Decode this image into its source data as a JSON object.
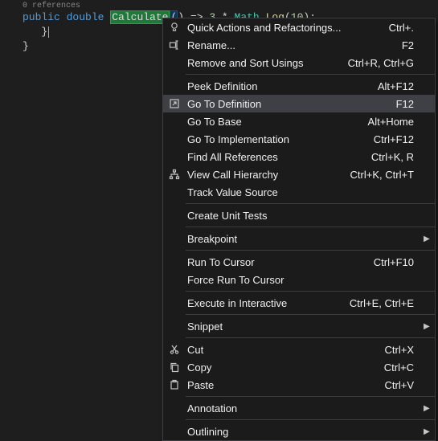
{
  "codelens": "0 references",
  "code": {
    "kw1": "public",
    "kw2": "double",
    "method": "Calculate",
    "paren_open": "(",
    "paren_close": ")",
    "arrow": " => ",
    "num1": "3",
    "star": " * ",
    "cls": "Math",
    "dot": ".",
    "call": "Log",
    "lp": "(",
    "num2": "10",
    "rp": ")",
    "semi": ";"
  },
  "braces": {
    "b1": "}",
    "b2": "}"
  },
  "menu": [
    {
      "type": "item",
      "icon": "bulb",
      "label": "Quick Actions and Refactorings...",
      "shortcut": "Ctrl+."
    },
    {
      "type": "item",
      "icon": "rename",
      "label": "Rename...",
      "shortcut": "F2"
    },
    {
      "type": "item",
      "icon": "",
      "label": "Remove and Sort Usings",
      "shortcut": "Ctrl+R, Ctrl+G"
    },
    {
      "type": "sep"
    },
    {
      "type": "item",
      "icon": "",
      "label": "Peek Definition",
      "shortcut": "Alt+F12"
    },
    {
      "type": "item",
      "icon": "goto",
      "label": "Go To Definition",
      "shortcut": "F12",
      "highlight": true
    },
    {
      "type": "item",
      "icon": "",
      "label": "Go To Base",
      "shortcut": "Alt+Home"
    },
    {
      "type": "item",
      "icon": "",
      "label": "Go To Implementation",
      "shortcut": "Ctrl+F12"
    },
    {
      "type": "item",
      "icon": "",
      "label": "Find All References",
      "shortcut": "Ctrl+K, R"
    },
    {
      "type": "item",
      "icon": "hierarchy",
      "label": "View Call Hierarchy",
      "shortcut": "Ctrl+K, Ctrl+T"
    },
    {
      "type": "item",
      "icon": "",
      "label": "Track Value Source",
      "shortcut": ""
    },
    {
      "type": "sep"
    },
    {
      "type": "item",
      "icon": "",
      "label": "Create Unit Tests",
      "shortcut": ""
    },
    {
      "type": "sep"
    },
    {
      "type": "item",
      "icon": "",
      "label": "Breakpoint",
      "shortcut": "",
      "submenu": true
    },
    {
      "type": "sep"
    },
    {
      "type": "item",
      "icon": "",
      "label": "Run To Cursor",
      "shortcut": "Ctrl+F10"
    },
    {
      "type": "item",
      "icon": "",
      "label": "Force Run To Cursor",
      "shortcut": ""
    },
    {
      "type": "sep"
    },
    {
      "type": "item",
      "icon": "",
      "label": "Execute in Interactive",
      "shortcut": "Ctrl+E, Ctrl+E"
    },
    {
      "type": "sep"
    },
    {
      "type": "item",
      "icon": "",
      "label": "Snippet",
      "shortcut": "",
      "submenu": true
    },
    {
      "type": "sep"
    },
    {
      "type": "item",
      "icon": "cut",
      "label": "Cut",
      "shortcut": "Ctrl+X"
    },
    {
      "type": "item",
      "icon": "copy",
      "label": "Copy",
      "shortcut": "Ctrl+C"
    },
    {
      "type": "item",
      "icon": "paste",
      "label": "Paste",
      "shortcut": "Ctrl+V"
    },
    {
      "type": "sep"
    },
    {
      "type": "item",
      "icon": "",
      "label": "Annotation",
      "shortcut": "",
      "submenu": true
    },
    {
      "type": "sep"
    },
    {
      "type": "item",
      "icon": "",
      "label": "Outlining",
      "shortcut": "",
      "submenu": true
    }
  ]
}
